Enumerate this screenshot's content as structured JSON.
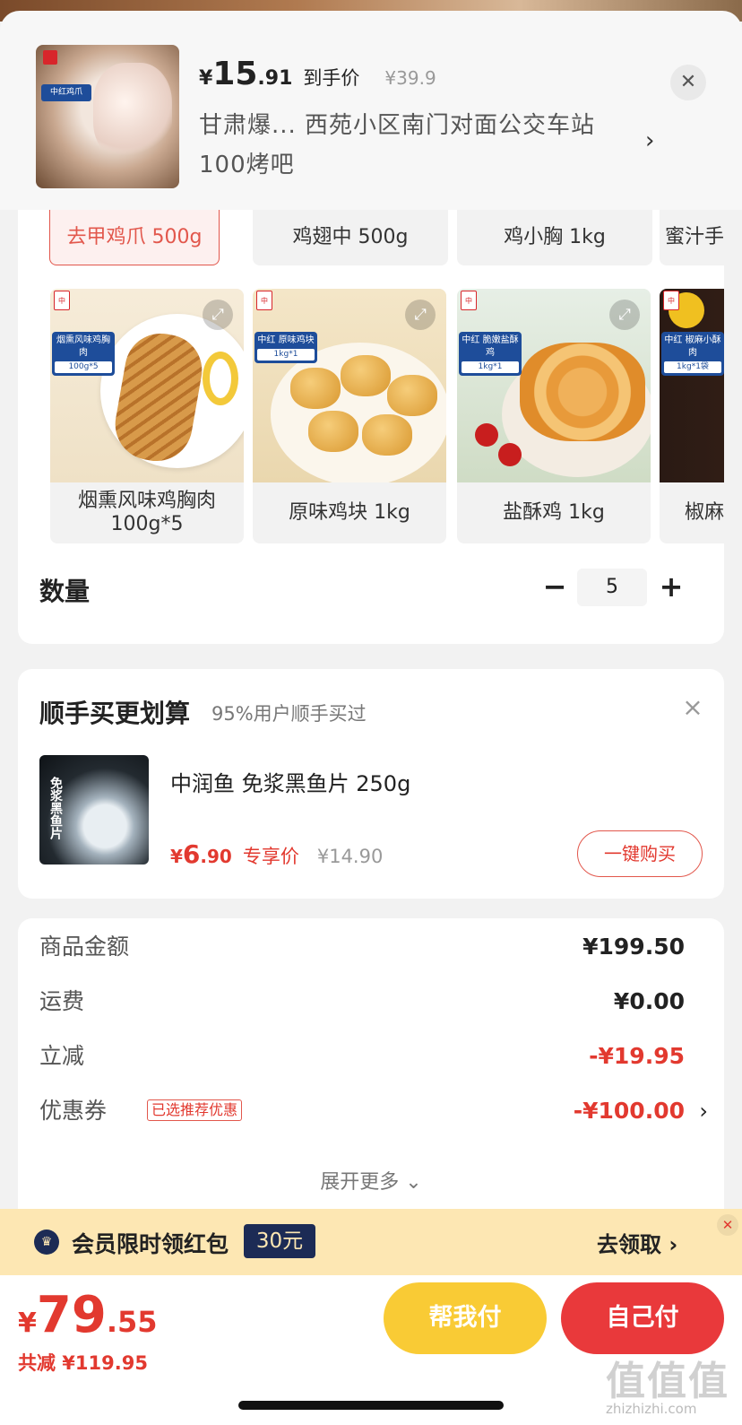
{
  "header": {
    "price_symbol": "¥",
    "price_int": "15",
    "price_dec": ".91",
    "price_tag": "到手价",
    "original_price": "¥39.9",
    "address": "甘肃爆... 西苑小区南门对面公交车站100烤吧",
    "thumb_label": "中红鸡爪"
  },
  "options": {
    "specs": [
      "去甲鸡爪 500g",
      "鸡翅中 500g",
      "鸡小胸 1kg",
      "蜜汁手"
    ],
    "products": [
      {
        "label": "烟熏风味鸡胸肉100g*5",
        "tag": "烟熏风味鸡胸肉",
        "tag_sub": "100g*5"
      },
      {
        "label": "原味鸡块 1kg",
        "tag": "中红 原味鸡块",
        "tag_sub": "1kg*1"
      },
      {
        "label": "盐酥鸡 1kg",
        "tag": "中红 脆嫩盐酥鸡",
        "tag_sub": "1kg*1"
      },
      {
        "label": "椒麻",
        "tag": "中红 椒麻小酥肉",
        "tag_sub": "1kg*1袋"
      }
    ],
    "qty_label": "数量",
    "qty_value": "5",
    "qty_minus": "−",
    "qty_plus": "+"
  },
  "upsell": {
    "title": "顺手买更划算",
    "subtitle": "95%用户顺手买过",
    "product_name": "中润鱼 免浆黑鱼片 250g",
    "price_symbol": "¥",
    "price_int": "6",
    "price_dec": ".90",
    "price_tag": "专享价",
    "original_price": "¥14.90",
    "buy_label": "一键购买",
    "img_text": "免浆黑鱼片"
  },
  "summary": {
    "rows": [
      {
        "key": "商品金额",
        "value": "¥199.50"
      },
      {
        "key": "运费",
        "value": "¥0.00"
      },
      {
        "key": "立减",
        "value": "-¥19.95"
      },
      {
        "key": "优惠券",
        "value": "-¥100.00",
        "tag": "已选推荐优惠"
      }
    ],
    "expand_more": "展开更多 ⌄"
  },
  "member": {
    "text": "会员限时领红包",
    "badge": "30元",
    "go": "去领取 ›"
  },
  "bottom": {
    "total_symbol": "¥",
    "total_int": "79",
    "total_dec": ".55",
    "saved": "共减 ¥119.95",
    "help_pay": "帮我付",
    "self_pay": "自己付"
  },
  "watermark": {
    "text": "值值值",
    "url": "zhizhizhi.com"
  },
  "colors": {
    "accent_red": "#e2392f",
    "pay_yellow": "#f9cb35",
    "pay_red": "#e9393b",
    "member_bg": "#fde7b3"
  }
}
